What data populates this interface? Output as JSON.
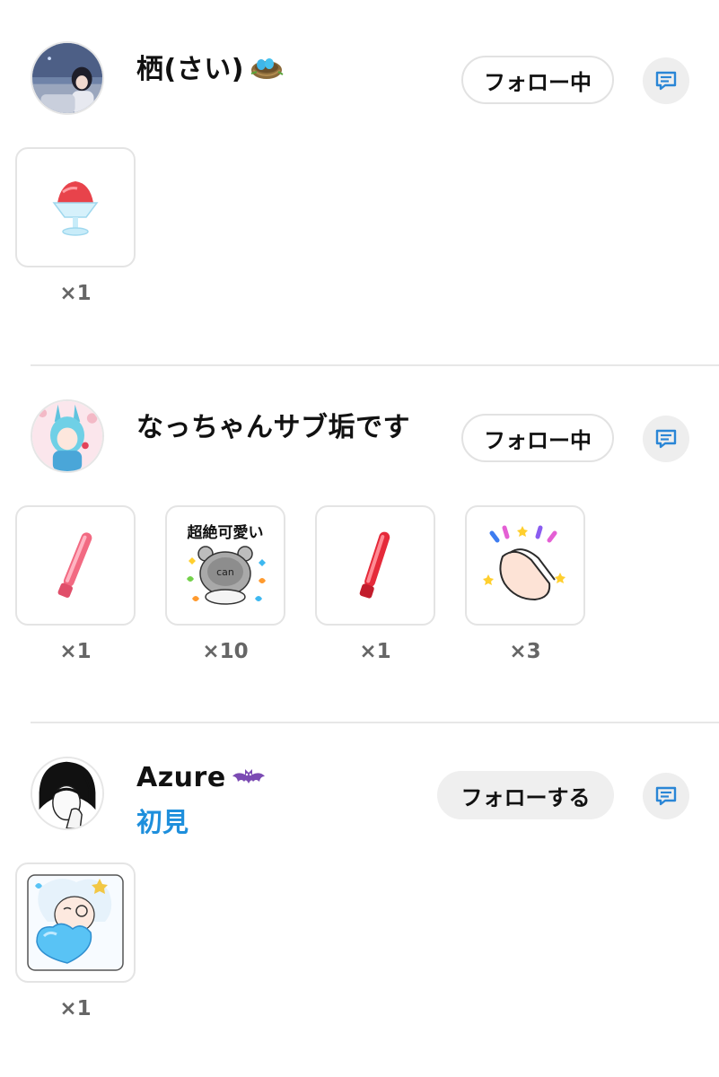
{
  "users": [
    {
      "name": "栖(さい)",
      "name_emoji": "nest-with-eggs-icon",
      "follow_label": "フォロー中",
      "follow_state": "following",
      "badge": "",
      "gifts": [
        {
          "icon": "shaved-ice-icon",
          "count": "×1"
        }
      ]
    },
    {
      "name": "なっちゃんサブ垢です",
      "name_emoji": "",
      "follow_label": "フォロー中",
      "follow_state": "following",
      "badge": "",
      "gifts": [
        {
          "icon": "pink-glowstick-icon",
          "count": "×1"
        },
        {
          "icon": "bear-sticker-icon",
          "count": "×10",
          "text": "超絶可愛い"
        },
        {
          "icon": "red-glowstick-icon",
          "count": "×1"
        },
        {
          "icon": "clapping-hands-icon",
          "count": "×3"
        }
      ]
    },
    {
      "name": "Azure",
      "name_emoji": "bat-icon",
      "follow_label": "フォローする",
      "follow_state": "not-following",
      "badge": "初見",
      "gifts": [
        {
          "icon": "anime-heart-sticker-icon",
          "count": "×1"
        }
      ]
    }
  ],
  "colors": {
    "badge_blue": "#1e8fdc",
    "message_icon_blue": "#2a86d6",
    "divider": "#e7e7e7"
  }
}
